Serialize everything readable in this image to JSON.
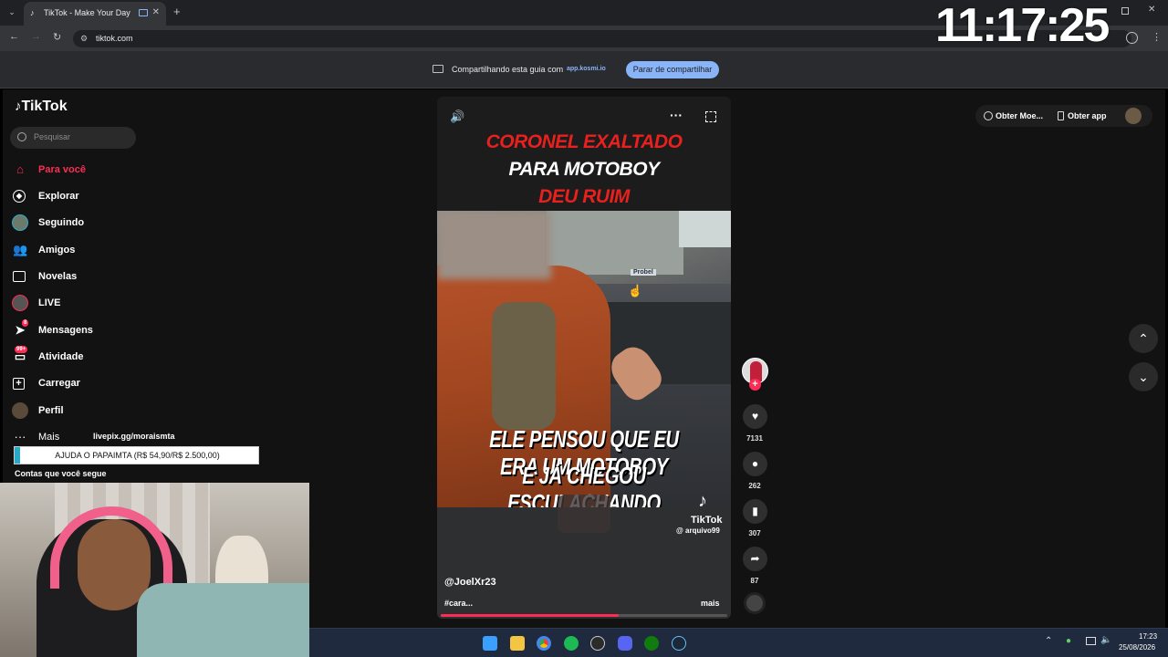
{
  "browser": {
    "tab_title": "TikTok - Make Your Day",
    "url": "tiktok.com",
    "new_tab": "+",
    "close_tab": "✕",
    "share_text": "Compartilhando esta guia com",
    "share_domain": "app.kosmi.io",
    "stop_share": "Parar de compartilhar"
  },
  "overlay_clock": "11:17:25",
  "tiktok": {
    "logo": "TikTok",
    "search_placeholder": "Pesquisar",
    "nav": [
      {
        "label": "Para você",
        "icon": "home-icon"
      },
      {
        "label": "Explorar",
        "icon": "compass-icon"
      },
      {
        "label": "Seguindo",
        "icon": "following-avatar-icon"
      },
      {
        "label": "Amigos",
        "icon": "friends-icon"
      },
      {
        "label": "Novelas",
        "icon": "novelas-icon"
      },
      {
        "label": "LIVE",
        "icon": "live-icon"
      },
      {
        "label": "Mensagens",
        "icon": "messages-icon",
        "badge": "8"
      },
      {
        "label": "Atividade",
        "icon": "activity-icon",
        "badge": "99+"
      },
      {
        "label": "Carregar",
        "icon": "upload-icon"
      },
      {
        "label": "Perfil",
        "icon": "profile-avatar-icon"
      },
      {
        "label": "Mais",
        "icon": "more-icon"
      }
    ],
    "following_title": "Contas que você segue",
    "topbar": {
      "coins": "Obter Moe...",
      "app": "Obter app"
    },
    "video": {
      "title_lines": [
        "CORONEL EXALTADO",
        "PARA MOTOBOY",
        "DEU RUIM"
      ],
      "caption_lines": [
        "ELE PENSOU QUE EU ERA UM MOTOBOY",
        "E JÁ CHEGOU ESCULACHANDO"
      ],
      "watermark_brand": "TikTok",
      "watermark_user": "@ arquivo99",
      "author": "@JoelXr23",
      "description": "#cara...",
      "more": "mais",
      "sign_text": "Probel",
      "progress": 0.62
    },
    "actions": {
      "likes": "7131",
      "comments": "262",
      "saves": "307",
      "shares": "87"
    }
  },
  "stream_overlay": {
    "pix_url": "livepix.gg/moraismta",
    "goal_text": "AJUDA O PAPAIMTA (R$ 54,90/R$ 2.500,00)",
    "goal_progress": 0.022
  },
  "taskbar": {
    "time": "17:23",
    "date": "25/08/2026"
  },
  "colors": {
    "accent": "#fe2c55",
    "title_red": "#e8201e",
    "share_button": "#8ab4f8"
  }
}
